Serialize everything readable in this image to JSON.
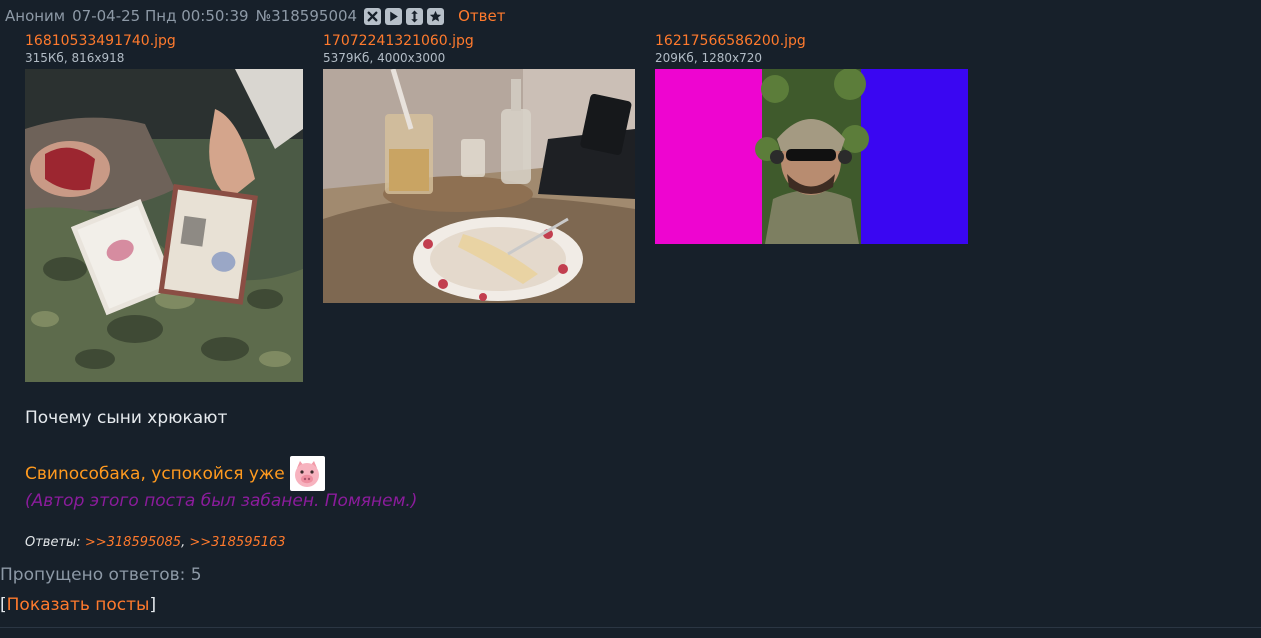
{
  "header": {
    "name": "Аноним",
    "date": "07-04-25 Пнд 00:50:39",
    "post_num": "№318595004",
    "buttons": [
      "hide-icon",
      "play-icon",
      "expand-icon",
      "star-icon"
    ],
    "reply_label": "Ответ"
  },
  "files": [
    {
      "name": "16810533491740.jpg",
      "meta": "315Кб, 816x918"
    },
    {
      "name": "17072241321060.jpg",
      "meta": "5379Кб, 4000x3000"
    },
    {
      "name": "16217566586200.jpg",
      "meta": "209Кб, 1280x720"
    }
  ],
  "post": {
    "text": "Почему сыни хрюкают",
    "quote": "Свиnособака, успокойся уже",
    "emoji": "pig-face-icon",
    "ban_notice": "(Автор этого поста был забанен. Помянем.)"
  },
  "replies": {
    "label": "Ответы:",
    "links": [
      ">>318595085",
      ">>318595163"
    ]
  },
  "skipped": "Пропущено ответов: 5",
  "show_posts": {
    "open": "[",
    "label": "Показать посты",
    "close": "]"
  },
  "colors": {
    "background": "#17202a",
    "accent": "#ff7a2d",
    "quote": "#ff9a1f",
    "ban": "#8b1c9c"
  }
}
